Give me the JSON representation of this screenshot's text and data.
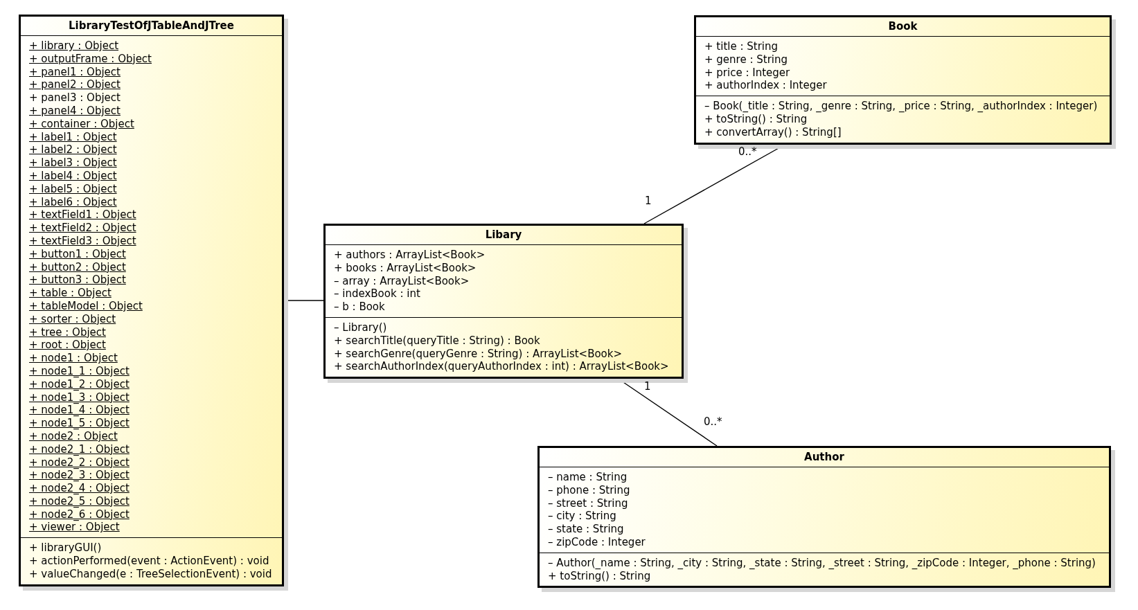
{
  "classes": [
    {
      "name": "LibraryTestOfJTableAndJTree",
      "attributes": [
        {
          "text": "+ library : Object",
          "static": true
        },
        {
          "text": "+ outputFrame : Object",
          "static": true
        },
        {
          "text": "+ panel1 : Object",
          "static": true
        },
        {
          "text": "+ panel2 : Object",
          "static": true
        },
        {
          "text": "+ panel3 : Object",
          "static": false
        },
        {
          "text": "+ panel4 : Object",
          "static": true
        },
        {
          "text": "+ container : Object",
          "static": true
        },
        {
          "text": "+ label1 : Object",
          "static": true
        },
        {
          "text": "+ label2 : Object",
          "static": true
        },
        {
          "text": "+ label3 : Object",
          "static": true
        },
        {
          "text": "+ label4 : Object",
          "static": true
        },
        {
          "text": "+ label5 : Object",
          "static": true
        },
        {
          "text": "+ label6 : Object",
          "static": true
        },
        {
          "text": "+ textField1 : Object",
          "static": true
        },
        {
          "text": "+ textField2 : Object",
          "static": true
        },
        {
          "text": "+ textField3 : Object",
          "static": true
        },
        {
          "text": "+ button1 : Object",
          "static": true
        },
        {
          "text": "+ button2 : Object",
          "static": true
        },
        {
          "text": "+ button3 : Object",
          "static": true
        },
        {
          "text": "+ table : Object",
          "static": true
        },
        {
          "text": "+ tableModel : Object",
          "static": true
        },
        {
          "text": "+ sorter : Object",
          "static": true
        },
        {
          "text": "+ tree : Object",
          "static": true
        },
        {
          "text": "+ root : Object",
          "static": true
        },
        {
          "text": "+ node1 : Object",
          "static": true
        },
        {
          "text": "+ node1_1 : Object",
          "static": true
        },
        {
          "text": "+ node1_2 : Object",
          "static": true
        },
        {
          "text": "+ node1_3 : Object",
          "static": true
        },
        {
          "text": "+ node1_4 : Object",
          "static": true
        },
        {
          "text": "+ node1_5 : Object",
          "static": true
        },
        {
          "text": "+ node2 : Object",
          "static": true
        },
        {
          "text": "+ node2_1 : Object",
          "static": true
        },
        {
          "text": "+ node2_2 : Object",
          "static": true
        },
        {
          "text": "+ node2_3 : Object",
          "static": true
        },
        {
          "text": "+ node2_4 : Object",
          "static": true
        },
        {
          "text": "+ node2_5 : Object",
          "static": true
        },
        {
          "text": "+ node2_6 : Object",
          "static": true
        },
        {
          "text": "+ viewer : Object",
          "static": true
        }
      ],
      "operations": [
        {
          "text": "+ libraryGUI()"
        },
        {
          "text": "+ actionPerformed(event : ActionEvent) : void"
        },
        {
          "text": "+ valueChanged(e : TreeSelectionEvent) : void"
        }
      ]
    },
    {
      "name": "Book",
      "attributes": [
        {
          "text": "+ title : String",
          "static": false
        },
        {
          "text": "+ genre : String",
          "static": false
        },
        {
          "text": "+ price : Integer",
          "static": false
        },
        {
          "text": "+ authorIndex : Integer",
          "static": false
        }
      ],
      "operations": [
        {
          "text": "– Book(_title : String, _genre : String, _price : String, _authorIndex : Integer)"
        },
        {
          "text": "+ toString() : String"
        },
        {
          "text": "+ convertArray() : String[]"
        }
      ]
    },
    {
      "name": "Libary",
      "attributes": [
        {
          "text": "+ authors : ArrayList<Book>",
          "static": false
        },
        {
          "text": "+ books : ArrayList<Book>",
          "static": false
        },
        {
          "text": "– array : ArrayList<Book>",
          "static": false
        },
        {
          "text": "– indexBook : int",
          "static": false
        },
        {
          "text": "– b : Book",
          "static": false
        }
      ],
      "operations": [
        {
          "text": "– Library()"
        },
        {
          "text": "+ searchTitle(queryTitle : String) : Book"
        },
        {
          "text": "+ searchGenre(queryGenre : String) : ArrayList<Book>"
        },
        {
          "text": "+ searchAuthorIndex(queryAuthorIndex : int) : ArrayList<Book>"
        }
      ]
    },
    {
      "name": "Author",
      "attributes": [
        {
          "text": "– name : String",
          "static": false
        },
        {
          "text": "– phone : String",
          "static": false
        },
        {
          "text": "– street : String",
          "static": false
        },
        {
          "text": "– city : String",
          "static": false
        },
        {
          "text": "– state : String",
          "static": false
        },
        {
          "text": "– zipCode : Integer",
          "static": false
        }
      ],
      "operations": [
        {
          "text": "– Author(_name : String, _city : String, _state : String, _street : String, _zipCode : Integer, _phone : String)"
        },
        {
          "text": "+ toString() : String"
        }
      ]
    }
  ],
  "associations": [
    {
      "kind": "plain"
    },
    {
      "kind": "multiplicity",
      "ends": [
        "1",
        "0..*"
      ]
    },
    {
      "kind": "multiplicity",
      "ends": [
        "1",
        "0..*"
      ]
    }
  ]
}
